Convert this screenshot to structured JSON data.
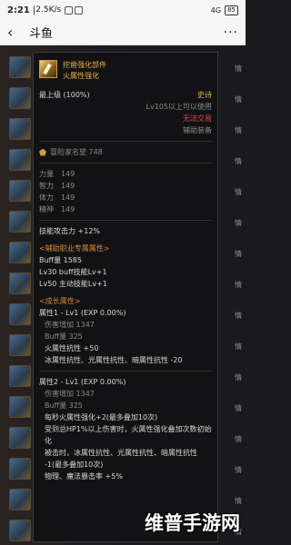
{
  "status": {
    "time": "2:21",
    "net_speed": "2.5K/s",
    "sim": "4G",
    "battery": "85"
  },
  "app": {
    "title": "斗鱼",
    "back_glyph": "‹",
    "more_glyph": "···"
  },
  "sidebar_labels": [
    "情",
    "情",
    "情",
    "情",
    "情",
    "情",
    "情",
    "情",
    "情",
    "情",
    "情",
    "情",
    "情",
    "情",
    "情",
    "情"
  ],
  "item": {
    "name": "挖凿强化部件",
    "subtitle": "火属性强化",
    "grade": "最上级 (100%)",
    "rarity": "史诗",
    "level_req": "Lv105以上可以使用",
    "trade": "无法交易",
    "type": "辅助装备",
    "fame": "冒险家名望 748",
    "stats": [
      {
        "label": "力量",
        "value": "149"
      },
      {
        "label": "智力",
        "value": "149"
      },
      {
        "label": "体力",
        "value": "149"
      },
      {
        "label": "精神",
        "value": "149"
      }
    ],
    "skill_atk": "技能攻击力  +12%",
    "buffer_title": "<辅助职业专属属性>",
    "buffer_lines": [
      "Buff量   1585",
      "Lv30 buff技能Lv+1",
      "Lv50 主动技能Lv+1"
    ],
    "growth_title": "<成长属性>",
    "attr1": {
      "title": "属性1 - Lv1 (EXP 0.00%)",
      "lines": [
        "伤害增加   1347",
        "Buff量   325"
      ],
      "effects": [
        "火属性抗性 +50",
        "冰属性抗性、光属性抗性、暗属性抗性 -20"
      ]
    },
    "attr2": {
      "title": "属性2 - Lv1 (EXP 0.00%)",
      "lines": [
        "伤害增加   1347",
        "Buff量   325"
      ],
      "effects": [
        "每秒火属性强化+2(最多叠加10次)",
        "受到总HP1%以上伤害时，火属性强化叠加次数初始化",
        "被击时，冰属性抗性、光属性抗性、暗属性抗性 -1(最多叠加10次)",
        "物理、魔法暴击率 +5%"
      ]
    }
  },
  "watermark": "维普手游网"
}
